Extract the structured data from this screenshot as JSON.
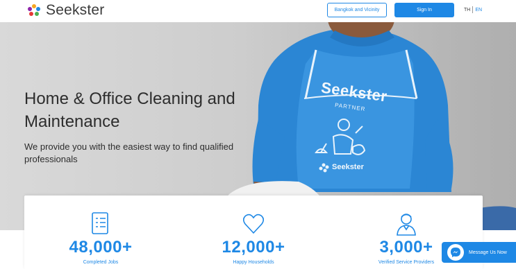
{
  "header": {
    "brand": "Seekster",
    "area_button": "Bangkok and Vicinity",
    "signin_button": "Sign In",
    "lang_th": "TH",
    "lang_en": "EN"
  },
  "hero": {
    "title": "Home & Office Cleaning and Maintenance",
    "subtitle": "We provide you with the easiest way to find qualified professionals",
    "apron_brand": "Seekster",
    "apron_tag": "PARTNER",
    "apron_logo_text": "Seekster"
  },
  "stats": [
    {
      "number": "48,000+",
      "label": "Completed Jobs",
      "icon": "document-checklist-icon"
    },
    {
      "number": "12,000+",
      "label": "Happy Households",
      "icon": "heart-icon"
    },
    {
      "number": "3,000+",
      "label": "Verified Service Providers",
      "icon": "worker-avatar-icon"
    }
  ],
  "messenger": {
    "label": "Message Us Now",
    "icon": "messenger-icon"
  },
  "colors": {
    "accent": "#1e88e5",
    "text": "#2d2d2d",
    "hero_bg": "#d0d0d0"
  }
}
